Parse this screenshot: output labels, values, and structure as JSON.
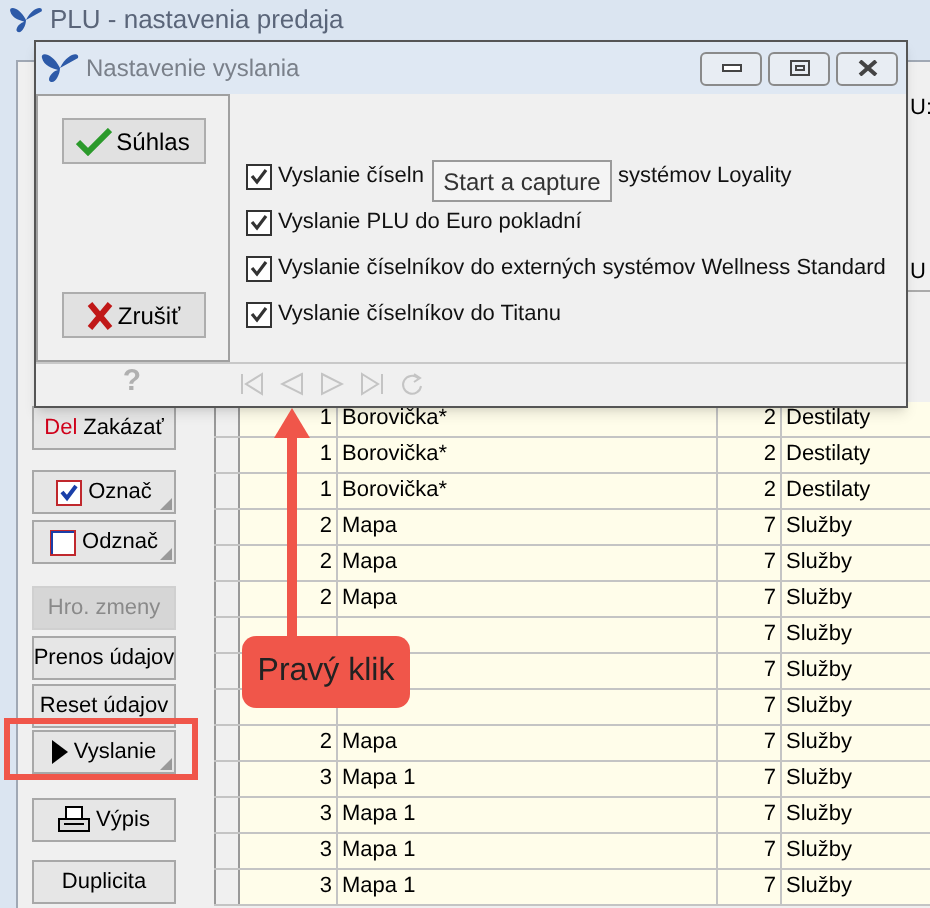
{
  "back_window": {
    "title": "PLU - nastavenia predaja",
    "field_label": "U:",
    "column_header": "U",
    "buttons": [
      {
        "kind": "del",
        "prefix": "Del",
        "label": "Zakázať",
        "disabled": false
      },
      {
        "kind": "check",
        "label": "Označ",
        "disabled": false
      },
      {
        "kind": "uncheck",
        "label": "Odznač",
        "disabled": false
      },
      {
        "kind": "plain",
        "label": "Hro. zmeny",
        "disabled": true
      },
      {
        "kind": "plain",
        "label": "Prenos údajov",
        "disabled": false
      },
      {
        "kind": "plain",
        "label": "Reset údajov",
        "disabled": false
      },
      {
        "kind": "play",
        "label": "Vyslanie",
        "disabled": false
      },
      {
        "kind": "print",
        "label": "Výpis",
        "disabled": false
      },
      {
        "kind": "plain",
        "label": "Duplicita",
        "disabled": false
      }
    ],
    "rows": [
      {
        "number": "1",
        "name": "Borovička*",
        "code": "2",
        "category": "Destilaty"
      },
      {
        "number": "1",
        "name": "Borovička*",
        "code": "2",
        "category": "Destilaty"
      },
      {
        "number": "1",
        "name": "Borovička*",
        "code": "2",
        "category": "Destilaty"
      },
      {
        "number": "2",
        "name": "Mapa",
        "code": "7",
        "category": "Služby"
      },
      {
        "number": "2",
        "name": "Mapa",
        "code": "7",
        "category": "Služby"
      },
      {
        "number": "2",
        "name": "Mapa",
        "code": "7",
        "category": "Služby"
      },
      {
        "code": "7",
        "category": "Služby"
      },
      {
        "code": "7",
        "category": "Služby"
      },
      {
        "code": "7",
        "category": "Služby"
      },
      {
        "number": "2",
        "name": "Mapa",
        "code": "7",
        "category": "Služby"
      },
      {
        "number": "3",
        "name": "Mapa 1",
        "code": "7",
        "category": "Služby"
      },
      {
        "number": "3",
        "name": "Mapa 1",
        "code": "7",
        "category": "Služby"
      },
      {
        "number": "3",
        "name": "Mapa 1",
        "code": "7",
        "category": "Služby"
      },
      {
        "number": "3",
        "name": "Mapa 1",
        "code": "7",
        "category": "Služby"
      }
    ]
  },
  "dialog": {
    "title": "Nastavenie vyslania",
    "ok_button": "Súhlas",
    "cancel_button": "Zrušiť",
    "options": [
      {
        "label": "Vyslanie číseln",
        "label_tail": "systémov Loyality",
        "checked": true
      },
      {
        "label": "Vyslanie PLU do Euro pokladní",
        "checked": true
      },
      {
        "label": "Vyslanie číselníkov do externých systémov Wellness Standard",
        "checked": true
      },
      {
        "label": "Vyslanie číselníkov do Titanu",
        "checked": true
      }
    ],
    "help": "?"
  },
  "tooltip": "Start a capture",
  "callout": "Pravý klik"
}
